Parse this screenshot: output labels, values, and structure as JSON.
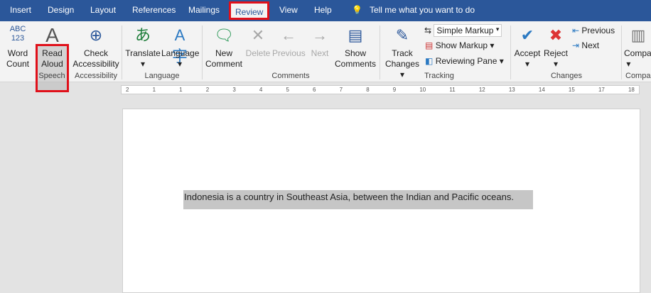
{
  "tabs": [
    "Insert",
    "Design",
    "Layout",
    "References",
    "Mailings",
    "Review",
    "View",
    "Help"
  ],
  "tell_me": "Tell me what you want to do",
  "ribbon": {
    "word_count": [
      "Word",
      "Count"
    ],
    "read_aloud": [
      "Read",
      "Aloud"
    ],
    "check_accessibility": [
      "Check",
      "Accessibility"
    ],
    "translate": "Translate",
    "language": "Language",
    "new_comment": [
      "New",
      "Comment"
    ],
    "delete": "Delete",
    "previous": "Previous",
    "next": "Next",
    "show_comments": [
      "Show",
      "Comments"
    ],
    "track_changes": [
      "Track",
      "Changes"
    ],
    "markup_select": "Simple Markup",
    "show_markup": "Show Markup",
    "reviewing_pane": "Reviewing Pane",
    "accept": "Accept",
    "reject": "Reject",
    "change_previous": "Previous",
    "change_next": "Next",
    "compare": "Compa",
    "groups": {
      "speech": "Speech",
      "accessibility": "Accessibility",
      "language": "Language",
      "comments": "Comments",
      "tracking": "Tracking",
      "changes": "Changes",
      "compare": "Compa"
    }
  },
  "ruler": [
    "2",
    "1",
    "1",
    "2",
    "3",
    "4",
    "5",
    "6",
    "7",
    "8",
    "9",
    "10",
    "11",
    "12",
    "13",
    "14",
    "15",
    "17",
    "18"
  ],
  "document": {
    "text": "Indonesia is a country in Southeast Asia, between the Indian and Pacific oceans."
  }
}
